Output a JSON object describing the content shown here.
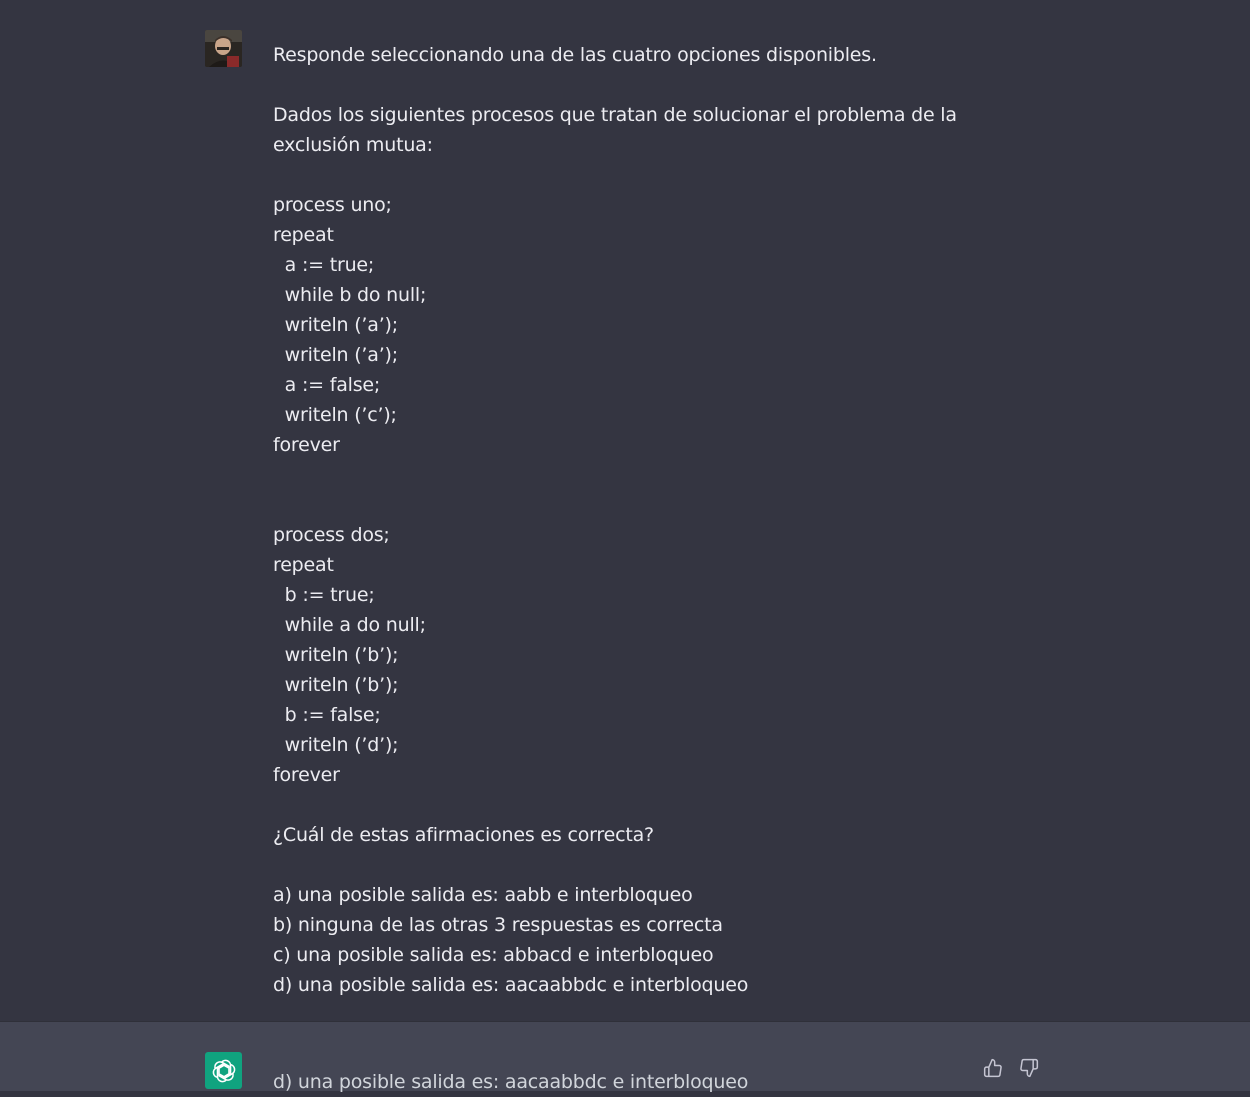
{
  "user_message": {
    "lines": [
      "Responde seleccionando una de las cuatro opciones disponibles.",
      "",
      "Dados los siguientes procesos que tratan de solucionar el problema de la",
      "exclusión mutua:",
      "",
      "process uno;",
      "repeat",
      "  a := true;",
      "  while b do null;",
      "  writeln (’a’);",
      "  writeln (’a’);",
      "  a := false;",
      "  writeln (’c’);",
      "forever",
      "",
      "",
      "process dos;",
      "repeat",
      "  b := true;",
      "  while a do null;",
      "  writeln (’b’);",
      "  writeln (’b’);",
      "  b := false;",
      "  writeln (’d’);",
      "forever",
      "",
      "¿Cuál de estas afirmaciones es correcta?",
      "",
      "a) una posible salida es: aabb e interbloqueo",
      "b) ninguna de las otras 3 respuestas es correcta",
      "c) una posible salida es: abbacd e interbloqueo",
      "d) una posible salida es: aacaabbdc e interbloqueo"
    ]
  },
  "assistant_message": {
    "text": "d) una posible salida es: aacaabbdc e interbloqueo"
  },
  "icons": {
    "user_avatar": "user-avatar-photo",
    "assistant_avatar": "openai-logo-icon",
    "like": "thumbs-up-icon",
    "dislike": "thumbs-down-icon"
  },
  "colors": {
    "user_bg": "#343541",
    "assistant_bg": "#444654",
    "logo_bg": "#10a37f"
  }
}
